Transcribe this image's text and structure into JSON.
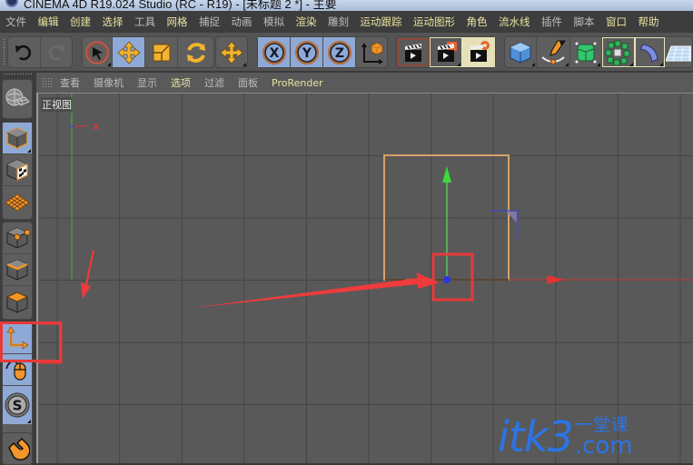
{
  "window": {
    "title": "CINEMA 4D R19.024 Studio (RC - R19) - [未标题 2 *] - 主要"
  },
  "menubar": {
    "items": [
      {
        "label": "文件",
        "color": "#bdbdbd"
      },
      {
        "label": "编辑",
        "color": "#e8e3a0"
      },
      {
        "label": "创建",
        "color": "#e8e3a0"
      },
      {
        "label": "选择",
        "color": "#e8e3a0"
      },
      {
        "label": "工具",
        "color": "#bdbdbd"
      },
      {
        "label": "网格",
        "color": "#e8e3a0"
      },
      {
        "label": "捕捉",
        "color": "#bdbdbd"
      },
      {
        "label": "动画",
        "color": "#bdbdbd"
      },
      {
        "label": "模拟",
        "color": "#bdbdbd"
      },
      {
        "label": "渲染",
        "color": "#e8e3a0"
      },
      {
        "label": "雕刻",
        "color": "#bdbdbd"
      },
      {
        "label": "运动跟踪",
        "color": "#e8e3a0"
      },
      {
        "label": "运动图形",
        "color": "#e8e3a0"
      },
      {
        "label": "角色",
        "color": "#e8e3a0"
      },
      {
        "label": "流水线",
        "color": "#e8e3a0"
      },
      {
        "label": "插件",
        "color": "#bdbdbd"
      },
      {
        "label": "脚本",
        "color": "#bdbdbd"
      },
      {
        "label": "窗口",
        "color": "#e8e3a0"
      },
      {
        "label": "帮助",
        "color": "#e8e3a0"
      }
    ]
  },
  "toolbar": {
    "undo": "undo-icon",
    "redo": "redo-icon",
    "tools": [
      "live-selection-icon",
      "move-icon",
      "scale-icon",
      "rotate-icon",
      "recent-tools-icon"
    ],
    "axes": [
      "X",
      "Y",
      "Z"
    ],
    "coord_system": "world-coordinate-icon",
    "render": [
      "render-view-icon",
      "render-to-picture-viewer-icon",
      "edit-render-settings-icon"
    ],
    "objects": [
      "cube-icon",
      "pen-spline-icon",
      "subdivision-surface-icon",
      "cloner-icon",
      "deformer-icon",
      "floor-icon"
    ]
  },
  "viewport_menu": {
    "items": [
      {
        "label": "查看",
        "color": "#bdbdbd"
      },
      {
        "label": "摄像机",
        "color": "#bdbdbd"
      },
      {
        "label": "显示",
        "color": "#bdbdbd"
      },
      {
        "label": "选项",
        "color": "#e8e3a0"
      },
      {
        "label": "过滤",
        "color": "#bdbdbd"
      },
      {
        "label": "面板",
        "color": "#bdbdbd"
      },
      {
        "label": "ProRender",
        "color": "#e8e3a0"
      }
    ]
  },
  "viewport": {
    "label": "正视图",
    "axis_label": "X"
  },
  "left_palette": {
    "items": [
      "make-editable-icon",
      "model-mode-icon",
      "texture-mode-icon",
      "workplane-mode-icon",
      "points-mode-icon",
      "edges-mode-icon",
      "polygons-mode-icon",
      "enable-axis-icon",
      "tweak-mode-icon",
      "solo-icon",
      "snap-icon"
    ]
  },
  "annotations": {
    "highlight_color": "#e8393a"
  },
  "watermark": {
    "main": "itk3",
    "cn": "一堂课",
    "com": ".com"
  },
  "colors": {
    "accent_active": "#8fa9d6",
    "object_outline": "#d7a064",
    "axis_x": "#e03030",
    "axis_y": "#30d030",
    "axis_z": "#2b3ae0"
  }
}
